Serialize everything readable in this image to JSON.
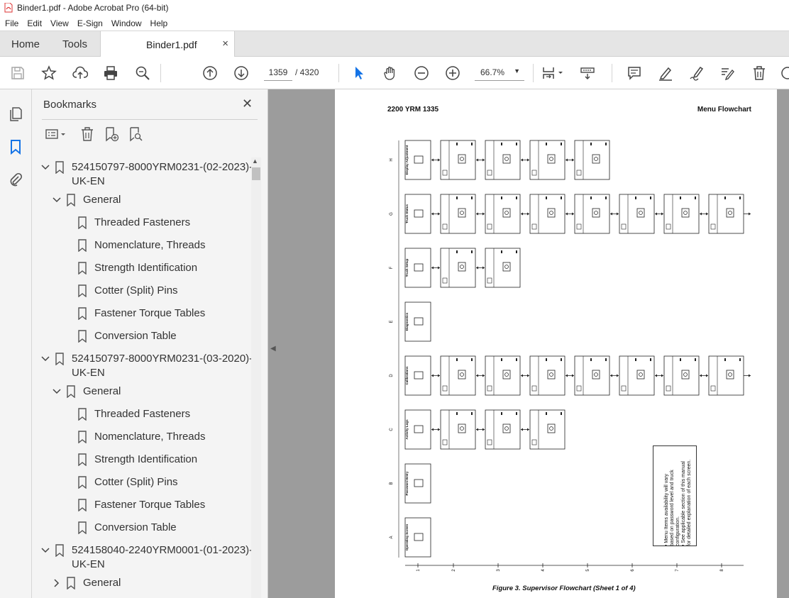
{
  "window": {
    "title": "Binder1.pdf - Adobe Acrobat Pro (64-bit)"
  },
  "menu": [
    "File",
    "Edit",
    "View",
    "E-Sign",
    "Window",
    "Help"
  ],
  "tabs": {
    "home": "Home",
    "tools": "Tools",
    "document": "Binder1.pdf"
  },
  "toolbar": {
    "page_current": "1359",
    "page_total": "/ 4320",
    "zoom": "66.7%"
  },
  "bookmarks": {
    "title": "Bookmarks",
    "items": [
      {
        "level": 0,
        "label": "524150797-8000YRM0231-(02-2023)-",
        "label2": "UK-EN",
        "expanded": true
      },
      {
        "level": 1,
        "label": "General",
        "expanded": true
      },
      {
        "level": 2,
        "label": "Threaded Fasteners"
      },
      {
        "level": 2,
        "label": "Nomenclature, Threads"
      },
      {
        "level": 2,
        "label": "Strength Identification"
      },
      {
        "level": 2,
        "label": "Cotter (Split) Pins"
      },
      {
        "level": 2,
        "label": "Fastener Torque Tables"
      },
      {
        "level": 2,
        "label": "Conversion Table"
      },
      {
        "level": 0,
        "label": "524150797-8000YRM0231-(03-2020)-",
        "label2": "UK-EN",
        "expanded": true
      },
      {
        "level": 1,
        "label": "General",
        "expanded": true
      },
      {
        "level": 2,
        "label": "Threaded Fasteners"
      },
      {
        "level": 2,
        "label": "Nomenclature, Threads"
      },
      {
        "level": 2,
        "label": "Strength Identification"
      },
      {
        "level": 2,
        "label": "Cotter (Split) Pins"
      },
      {
        "level": 2,
        "label": "Fastener Torque Tables"
      },
      {
        "level": 2,
        "label": "Conversion Table"
      },
      {
        "level": 0,
        "label": "524158040-2240YRM0001-(01-2023)-",
        "label2": "UK-EN",
        "expanded": true
      },
      {
        "level": 1,
        "label": "General",
        "expanded": false
      }
    ]
  },
  "pdf_page": {
    "header_left": "2200 YRM 1335",
    "header_right": "Menu Flowchart",
    "figure_caption": "Figure 3. Supervisor Flowchart (Sheet 1 of 4)",
    "rows": [
      {
        "letter": "H",
        "title": "Display Adjustment",
        "count": 5
      },
      {
        "letter": "G",
        "title": "Truck Status",
        "count": 8
      },
      {
        "letter": "F",
        "title": "Truck Setup",
        "count": 3
      },
      {
        "letter": "E",
        "title": "Diagnostics",
        "count": 1
      },
      {
        "letter": "D",
        "title": "Calibrations",
        "count": 8
      },
      {
        "letter": "C",
        "title": "Activity Logs",
        "count": 4
      },
      {
        "letter": "B",
        "title": "Password Entry",
        "count": 1
      },
      {
        "letter": "A",
        "title": "Operating Screen",
        "count": 1
      }
    ],
    "columns": [
      "1",
      "2",
      "3",
      "4",
      "5",
      "6",
      "7",
      "8"
    ],
    "note_lines": [
      "• Menu Items availability will vary",
      "based on password level and truck",
      "configuration.",
      "• See applicable section of this manual",
      "for detailed explanation of each screen."
    ]
  }
}
